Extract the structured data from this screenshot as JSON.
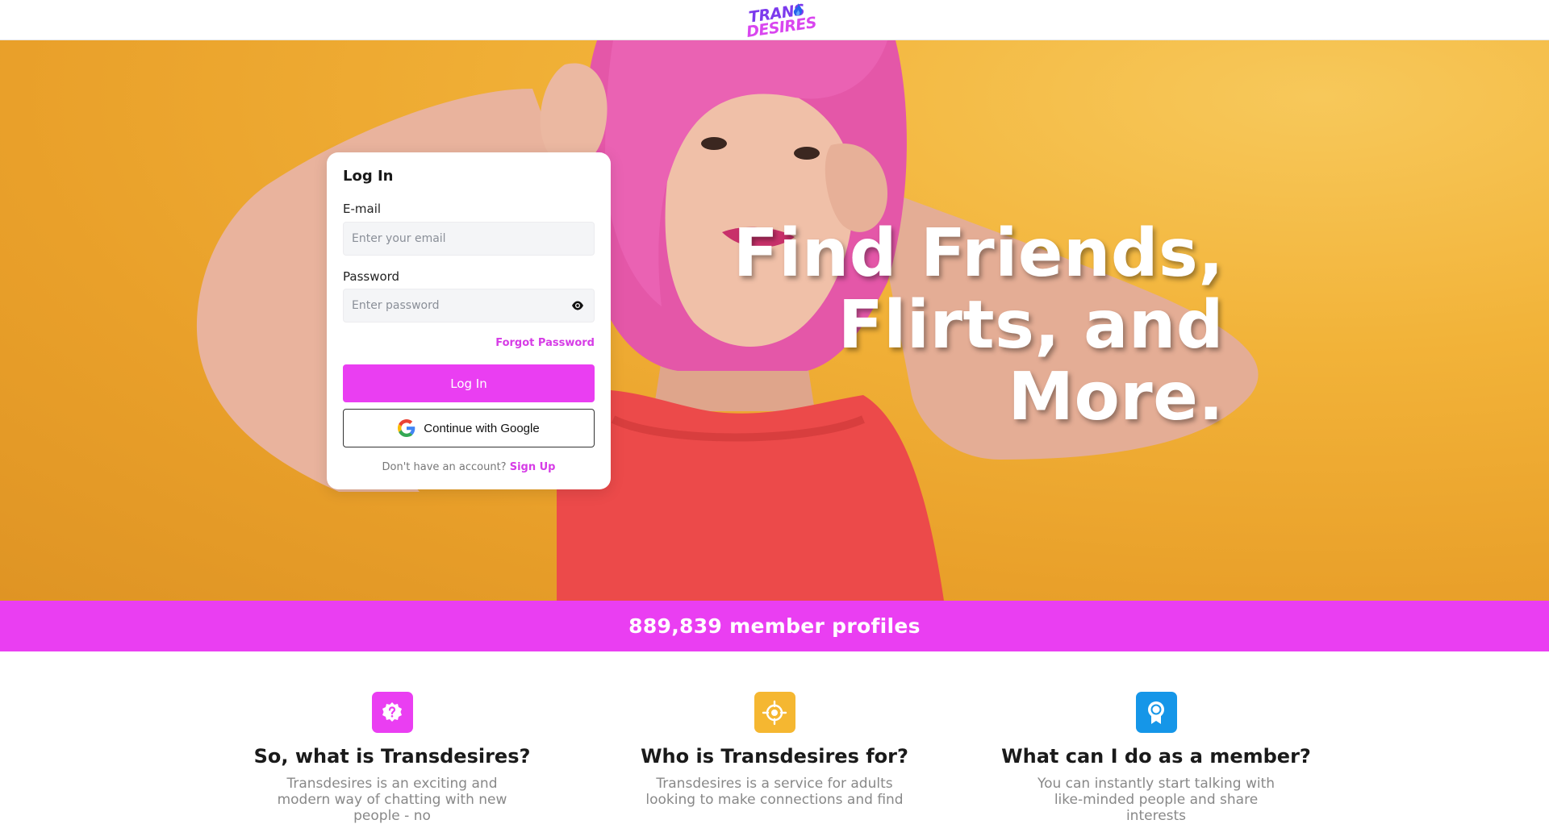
{
  "header": {
    "logo_line1": "TRANS",
    "logo_line2": "DESIRES"
  },
  "hero": {
    "headline_line1": "Find Friends,",
    "headline_line2": "Flirts, and",
    "headline_line3": "More."
  },
  "login": {
    "title": "Log In",
    "email_label": "E-mail",
    "email_placeholder": "Enter your email",
    "email_value": "",
    "password_label": "Password",
    "password_placeholder": "Enter password",
    "password_value": "",
    "forgot_label": "Forgot Password",
    "submit_label": "Log In",
    "google_label": "Continue with Google",
    "no_account_text": "Don't have an account?",
    "signup_label": "Sign Up"
  },
  "stats": {
    "members_text": "889,839 member profiles"
  },
  "features": [
    {
      "icon": "question-badge-icon",
      "color": "#ea3ef2",
      "title": "So, what is Transdesires?",
      "text": "Transdesires is an exciting and modern way of chatting with new people - no"
    },
    {
      "icon": "target-icon",
      "color": "#f5b731",
      "title": "Who is Transdesires for?",
      "text": "Transdesires is a service for adults looking to make connections and find"
    },
    {
      "icon": "award-ribbon-icon",
      "color": "#1596e8",
      "title": "What can I do as a member?",
      "text": "You can instantly start talking with like-minded people and share interests"
    }
  ],
  "colors": {
    "accent": "#ea3ef2",
    "link": "#d63ce6",
    "hero_bg": "#f2b339"
  }
}
